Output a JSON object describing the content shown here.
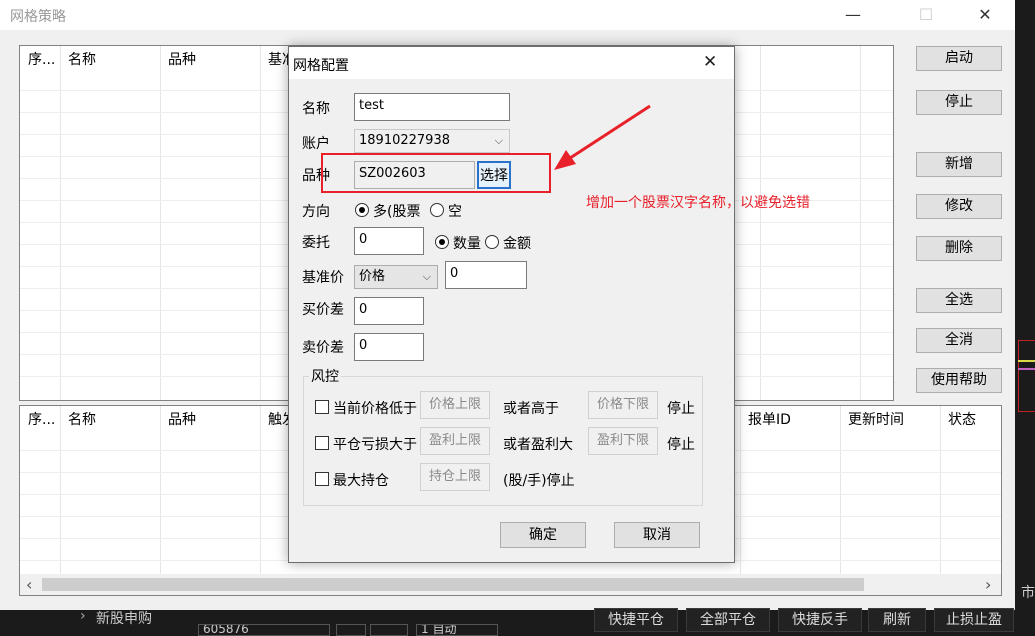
{
  "main": {
    "title": "网格策略",
    "window_controls": {
      "minimize": "—",
      "maximize": "☐",
      "close": "✕"
    },
    "top_table": {
      "headers": [
        "序...",
        "名称",
        "品种",
        "基准"
      ]
    },
    "bottom_table": {
      "headers": [
        "序...",
        "名称",
        "品种",
        "触发",
        "报单ID",
        "更新时间",
        "状态"
      ]
    },
    "buttons": {
      "start": "启动",
      "stop": "停止",
      "add": "新增",
      "edit": "修改",
      "delete": "删除",
      "select_all": "全选",
      "deselect_all": "全消",
      "help": "使用帮助"
    },
    "scroll": {
      "left": "‹",
      "right": "›"
    }
  },
  "bottombar": {
    "left_item": "新股申购",
    "left_caret": "›",
    "partial_code": "605876",
    "partial_auto": "1 自动",
    "buttons": [
      "快捷平仓",
      "全部平仓",
      "快捷反手",
      "刷新",
      "止损止盈"
    ],
    "right_edge": "市"
  },
  "dialog": {
    "title": "网格配置",
    "close": "✕",
    "name_label": "名称",
    "name_value": "test",
    "account_label": "账户",
    "account_value": "18910227938",
    "symbol_label": "品种",
    "symbol_value": "SZ002603",
    "select_button": "选择",
    "direction_label": "方向",
    "direction_long": "多(股票",
    "direction_short": "空",
    "order_label": "委托",
    "order_value": "0",
    "order_qty": "数量",
    "order_amount": "金额",
    "base_label": "基准价",
    "base_type": "价格",
    "base_value": "0",
    "buy_diff_label": "买价差",
    "buy_diff_value": "0",
    "sell_diff_label": "卖价差",
    "sell_diff_value": "0",
    "risk_group": "风控",
    "risk1_label": "当前价格低于",
    "risk1_placeholder": "价格上限",
    "risk1_or": "或者高于",
    "risk1_placeholder2": "价格下限",
    "risk1_stop": "停止",
    "risk2_label": "平仓亏损大于",
    "risk2_placeholder": "盈利上限",
    "risk2_or": "或者盈利大",
    "risk2_placeholder2": "盈利下限",
    "risk2_stop": "停止",
    "risk3_label": "最大持仓",
    "risk3_placeholder": "持仓上限",
    "risk3_unit": "(股/手)停止",
    "ok": "确定",
    "cancel": "取消"
  },
  "annotation": {
    "text": "增加一个股票汉字名称，以避免选错",
    "color": "#e8202a"
  }
}
